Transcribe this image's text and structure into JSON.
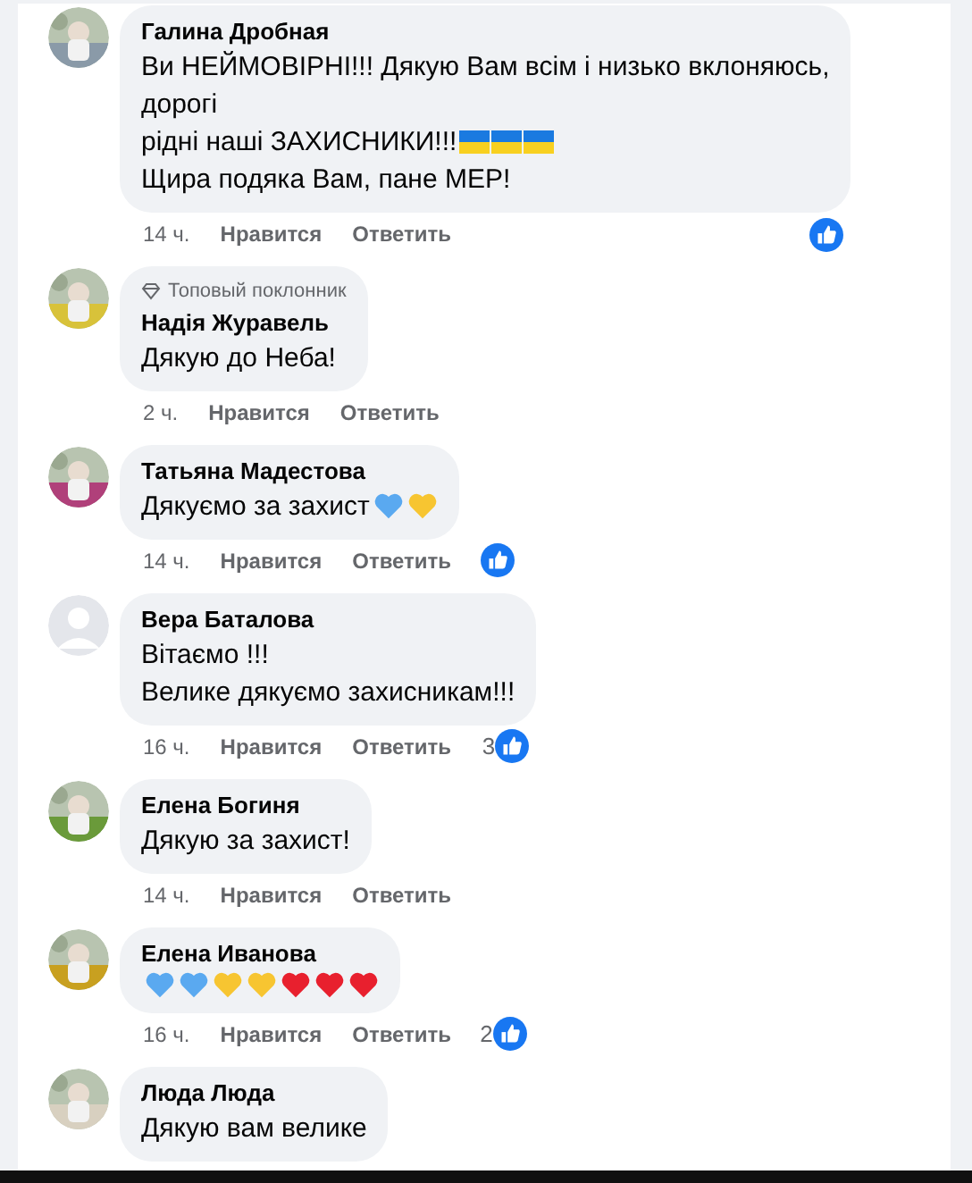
{
  "comments": [
    {
      "avatar": {
        "kind": "picture"
      },
      "author": "Галина Дробная",
      "lines": [
        {
          "text": "Ви НЕЙМОВІРНІ!!! Дякую Вам всім і низько вклоняюсь,"
        },
        {
          "text": "дорогі"
        },
        {
          "text": "рідні наші ЗАХИСНИКИ!!!",
          "emojis": [
            {
              "kind": "flag"
            },
            {
              "kind": "flag"
            },
            {
              "kind": "flag"
            }
          ]
        },
        {
          "text": "Щира подяка Вам, пане МЕР!"
        }
      ],
      "time": "14 ч.",
      "like": "Нравится",
      "reply": "Ответить",
      "reaction": {
        "kind": "like"
      }
    },
    {
      "avatar": {
        "kind": "picture"
      },
      "badge": "Топовый поклонник",
      "author": "Надія Журавель",
      "lines": [
        {
          "text": "Дякую до Неба!"
        }
      ],
      "time": "2 ч.",
      "like": "Нравится",
      "reply": "Ответить"
    },
    {
      "avatar": {
        "kind": "picture"
      },
      "author": "Татьяна Мадестова",
      "lines": [
        {
          "text": "Дякуємо за захист",
          "emojis": [
            {
              "kind": "heart",
              "color": "#5aa9f0"
            },
            {
              "kind": "heart",
              "color": "#f7c531"
            }
          ]
        }
      ],
      "time": "14 ч.",
      "like": "Нравится",
      "reply": "Ответить",
      "reaction": {
        "kind": "like"
      }
    },
    {
      "avatar": {
        "kind": "default"
      },
      "author": "Вера Баталова",
      "lines": [
        {
          "text": "Вітаємо !!!"
        },
        {
          "text": "Велике дякуємо захисникам!!!"
        }
      ],
      "time": "16 ч.",
      "like": "Нравится",
      "reply": "Ответить",
      "reaction": {
        "kind": "like",
        "count": "3"
      }
    },
    {
      "avatar": {
        "kind": "picture"
      },
      "author": "Елена Богиня",
      "lines": [
        {
          "text": "Дякую за захист!"
        }
      ],
      "time": "14 ч.",
      "like": "Нравится",
      "reply": "Ответить"
    },
    {
      "avatar": {
        "kind": "picture"
      },
      "author": "Елена Иванова",
      "lines": [
        {
          "emojis": [
            {
              "kind": "heart",
              "color": "#5aa9f0"
            },
            {
              "kind": "heart",
              "color": "#5aa9f0"
            },
            {
              "kind": "heart",
              "color": "#f7c531"
            },
            {
              "kind": "heart",
              "color": "#f7c531"
            },
            {
              "kind": "heart",
              "color": "#e8202e"
            },
            {
              "kind": "heart",
              "color": "#e8202e"
            },
            {
              "kind": "heart",
              "color": "#e8202e"
            }
          ]
        }
      ],
      "time": "16 ч.",
      "like": "Нравится",
      "reply": "Ответить",
      "reaction": {
        "kind": "like",
        "count": "2"
      }
    },
    {
      "avatar": {
        "kind": "picture"
      },
      "author": "Люда Люда",
      "lines": [
        {
          "text": "Дякую вам велике"
        }
      ]
    }
  ]
}
